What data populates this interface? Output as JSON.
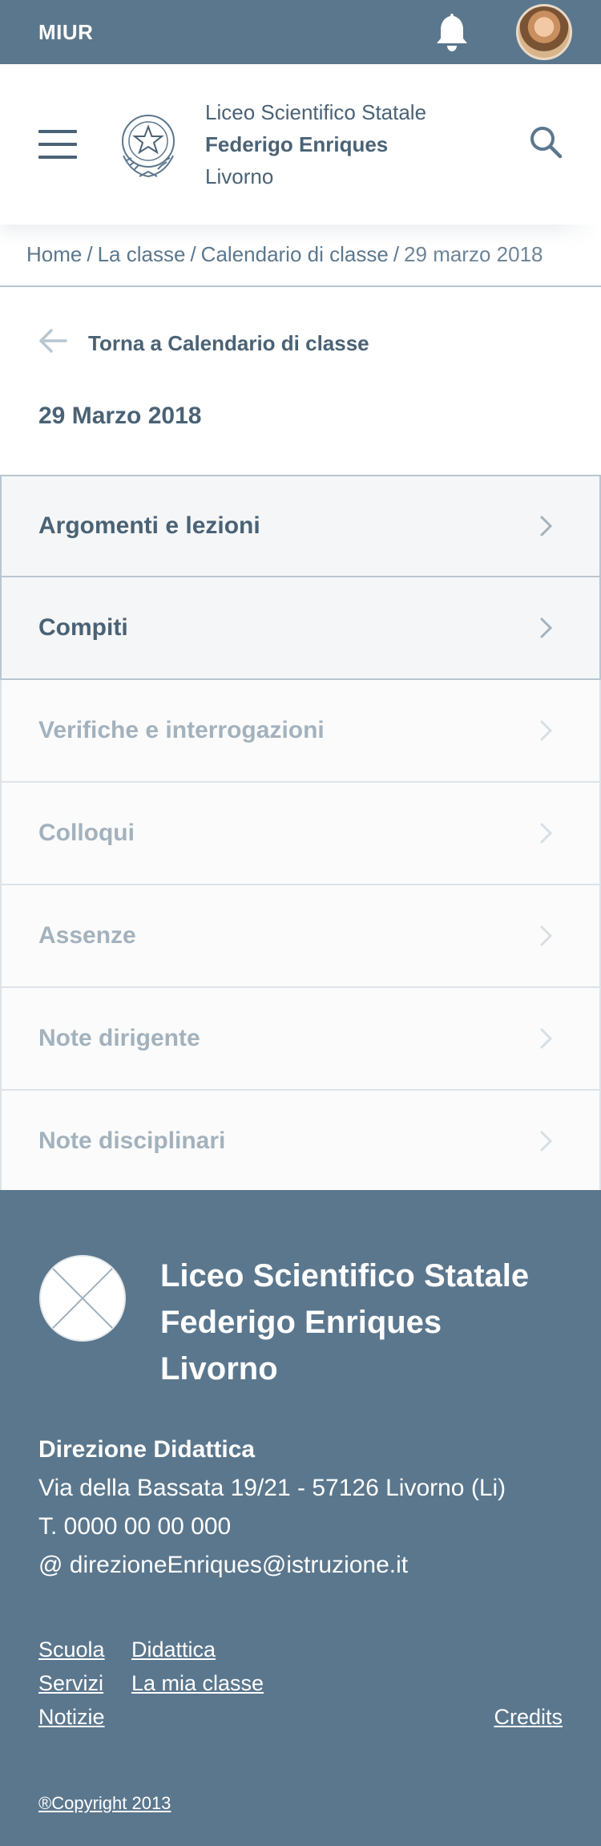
{
  "topbar": {
    "label": "MIUR",
    "icons": [
      "bell-icon",
      "user-avatar"
    ]
  },
  "header": {
    "school_line1": "Liceo Scientifico Statale",
    "school_line2": "Federigo Enriques",
    "school_line3": "Livorno",
    "icons": [
      "hamburger-menu-icon",
      "emblem-icon",
      "search-icon"
    ]
  },
  "breadcrumb": {
    "items": [
      "Home",
      "La classe",
      "Calendario di classe",
      "29 marzo 2018"
    ]
  },
  "back_link": {
    "label": "Torna a Calendario di classe",
    "icon": "arrow-left-icon"
  },
  "page": {
    "date_title": "29 Marzo 2018"
  },
  "menu": {
    "items": [
      {
        "label": "Argomenti e lezioni",
        "state": "active"
      },
      {
        "label": "Compiti",
        "state": "active"
      },
      {
        "label": "Verifiche e interrogazioni",
        "state": "inactive"
      },
      {
        "label": "Colloqui",
        "state": "inactive"
      },
      {
        "label": "Assenze",
        "state": "inactive"
      },
      {
        "label": "Note dirigente",
        "state": "inactive"
      },
      {
        "label": "Note disciplinari",
        "state": "inactive"
      }
    ]
  },
  "footer": {
    "name_line1": "Liceo Scientifico Statale",
    "name_line2": "Federigo Enriques",
    "name_line3": "Livorno",
    "contact_title": "Direzione Didattica",
    "address": "Via della Bassata 19/21 - 57126 Livorno (Li)",
    "phone": "T. 0000 00 00 000",
    "email": "@ direzioneEnriques@istruzione.it",
    "links": {
      "scuola": "Scuola",
      "didattica": "Didattica",
      "servizi": "Servizi",
      "la_mia_classe": "La mia classe",
      "notizie": "Notizie",
      "credits": "Credits"
    },
    "copyright": "®Copyright 2013"
  },
  "colors": {
    "primary": "#5b778d",
    "text": "#4a6275",
    "muted_text": "#a3b2bd",
    "border": "#b8c6d1"
  }
}
